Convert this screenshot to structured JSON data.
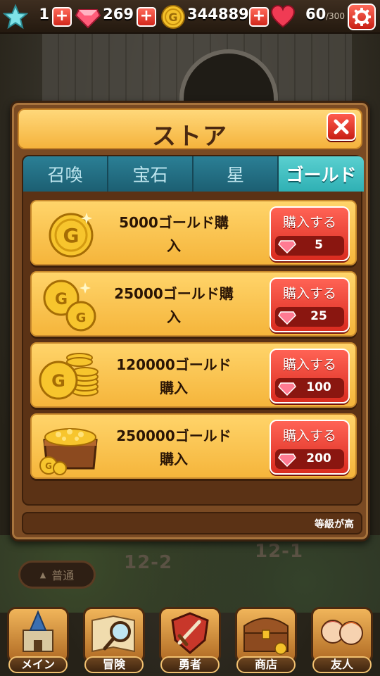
{
  "hud": {
    "stars": "1",
    "gems": "269",
    "gold": "344889",
    "hearts": "60",
    "hearts_max": "/300"
  },
  "map": {
    "stage_a": "12-2",
    "stage_b": "12-1",
    "difficulty_label": "普通"
  },
  "store": {
    "title": "ストア",
    "tabs": [
      {
        "label": "召喚",
        "active": false
      },
      {
        "label": "宝石",
        "active": false
      },
      {
        "label": "星",
        "active": false
      },
      {
        "label": "ゴールド",
        "active": true
      }
    ],
    "items": [
      {
        "name_line1": "5000ゴールド購",
        "name_line2": "入",
        "buy_label": "購入する",
        "price": "5",
        "icon": "single-gold-coin-icon"
      },
      {
        "name_line1": "25000ゴールド購",
        "name_line2": "入",
        "buy_label": "購入する",
        "price": "25",
        "icon": "two-gold-coins-icon"
      },
      {
        "name_line1": "120000ゴールド",
        "name_line2": "購入",
        "buy_label": "購入する",
        "price": "100",
        "icon": "gold-coin-stacks-icon"
      },
      {
        "name_line1": "250000ゴールド",
        "name_line2": "購入",
        "buy_label": "購入する",
        "price": "200",
        "icon": "treasure-chest-gold-icon"
      }
    ],
    "footer": "等級が高"
  },
  "nav": [
    {
      "label": "メイン",
      "icon": "castle-icon"
    },
    {
      "label": "冒険",
      "icon": "map-magnifier-icon"
    },
    {
      "label": "勇者",
      "icon": "sword-shield-icon"
    },
    {
      "label": "商店",
      "icon": "treasure-chest-icon"
    },
    {
      "label": "友人",
      "icon": "friends-icon"
    }
  ],
  "colors": {
    "accent_red": "#d92b1f",
    "tab_active": "#2fb0b4",
    "tab_inactive": "#1c5f72",
    "item_bg": "#f5b53b",
    "dialog_bg": "#7a4a23"
  }
}
